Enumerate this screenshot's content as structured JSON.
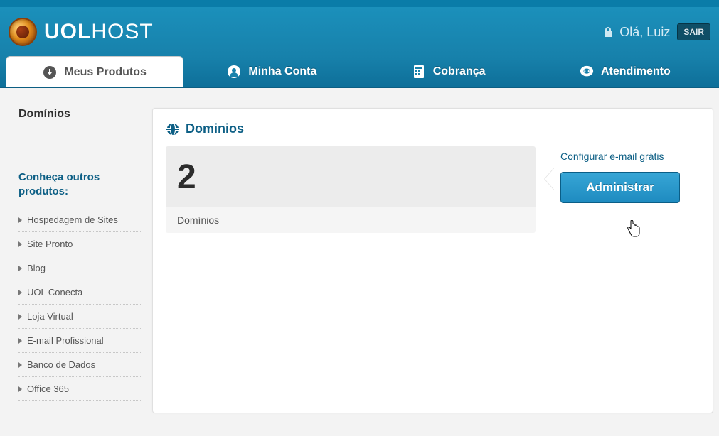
{
  "brand": {
    "bold": "UOL",
    "light": "HOST"
  },
  "header": {
    "greeting": "Olá, Luiz",
    "logout": "SAIR"
  },
  "tabs": [
    {
      "label": "Meus Produtos",
      "icon": "download"
    },
    {
      "label": "Minha Conta",
      "icon": "user"
    },
    {
      "label": "Cobrança",
      "icon": "billing"
    },
    {
      "label": "Atendimento",
      "icon": "support"
    }
  ],
  "sidebar": {
    "title": "Domínios",
    "subtitle": "Conheça outros produtos:",
    "items": [
      {
        "label": "Hospedagem de Sites"
      },
      {
        "label": "Site Pronto"
      },
      {
        "label": "Blog"
      },
      {
        "label": "UOL Conecta"
      },
      {
        "label": "Loja Virtual"
      },
      {
        "label": "E-mail Profissional"
      },
      {
        "label": "Banco de Dados"
      },
      {
        "label": "Office 365"
      }
    ]
  },
  "main": {
    "title": "Dominios",
    "stat_value": "2",
    "stat_label": "Domínios",
    "config_link": "Configurar e-mail grátis",
    "admin_button": "Administrar"
  }
}
